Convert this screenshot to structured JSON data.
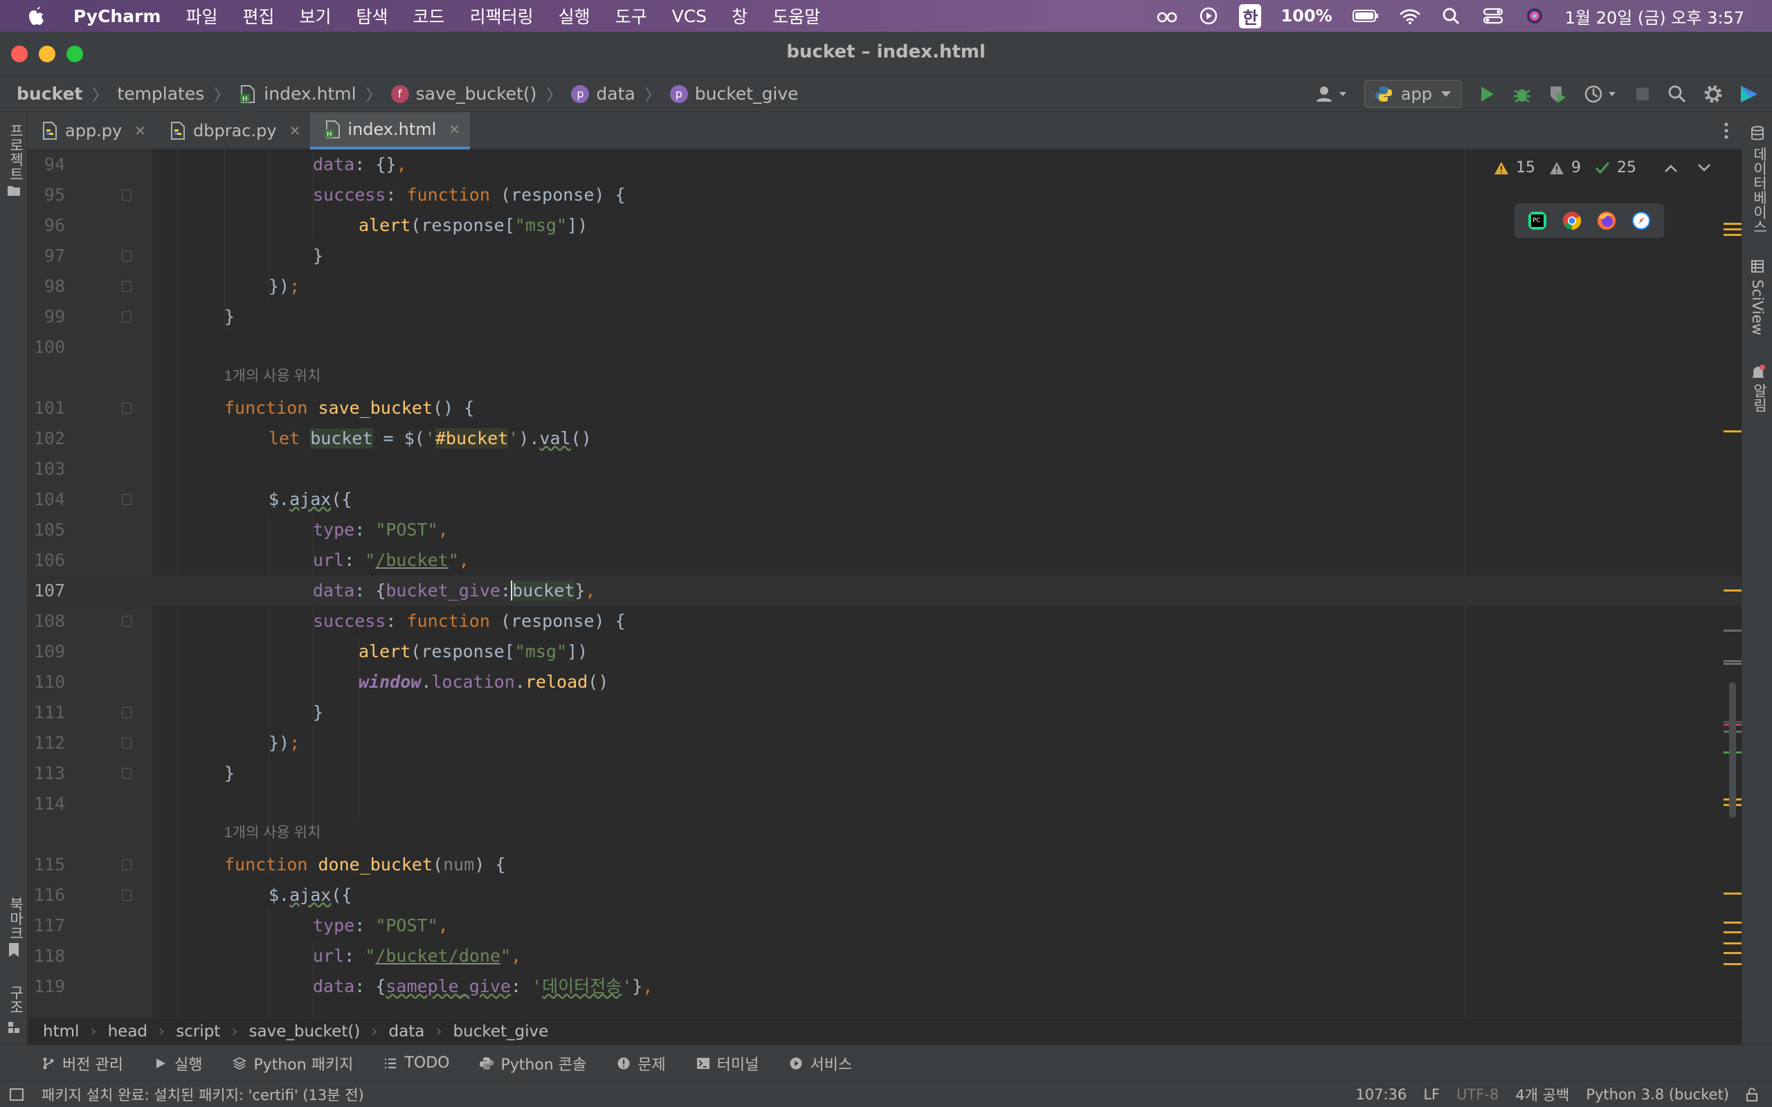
{
  "menubar": {
    "app": "PyCharm",
    "items": [
      "파일",
      "편집",
      "보기",
      "탐색",
      "코드",
      "리팩터링",
      "실행",
      "도구",
      "VCS",
      "창",
      "도움말"
    ],
    "input_method": "한",
    "battery": "100%",
    "clock": "1월 20일 (금) 오후 3:57"
  },
  "window": {
    "title": "bucket – index.html"
  },
  "navbar": {
    "crumbs": [
      "bucket",
      "templates",
      "index.html",
      "save_bucket()",
      "data",
      "bucket_give"
    ],
    "run_config": "app"
  },
  "tabs": [
    {
      "label": "app.py",
      "active": false
    },
    {
      "label": "dbprac.py",
      "active": false
    },
    {
      "label": "index.html",
      "active": true
    }
  ],
  "left_strip": {
    "project": "프로젝트",
    "bookmarks": "북마크",
    "structure": "구조"
  },
  "right_strip": {
    "database": "데이터베이스",
    "sciview": "SciView",
    "notifications": "알림"
  },
  "inspections": {
    "warnings": "15",
    "weak_warnings": "9",
    "ok": "25"
  },
  "code": {
    "hint": "1개의 사용 위치",
    "line_numbers": [
      "94",
      "95",
      "96",
      "97",
      "98",
      "99",
      "100",
      "101",
      "102",
      "103",
      "104",
      "105",
      "106",
      "107",
      "108",
      "109",
      "110",
      "111",
      "112",
      "113",
      "114",
      "115",
      "116",
      "117",
      "118",
      "119"
    ]
  },
  "breadcrumbs_bottom": [
    "html",
    "head",
    "script",
    "save_bucket()",
    "data",
    "bucket_give"
  ],
  "toolwindows": [
    "버전 관리",
    "실행",
    "Python 패키지",
    "TODO",
    "Python 콘솔",
    "문제",
    "터미널",
    "서비스"
  ],
  "status": {
    "message": "패키지 설치 완료: 설치된 패키지: 'certifi' (13분 전)",
    "position": "107:36",
    "line_sep": "LF",
    "encoding": "UTF-8",
    "indent": "4개 공백",
    "interpreter": "Python 3.8 (bucket)"
  }
}
